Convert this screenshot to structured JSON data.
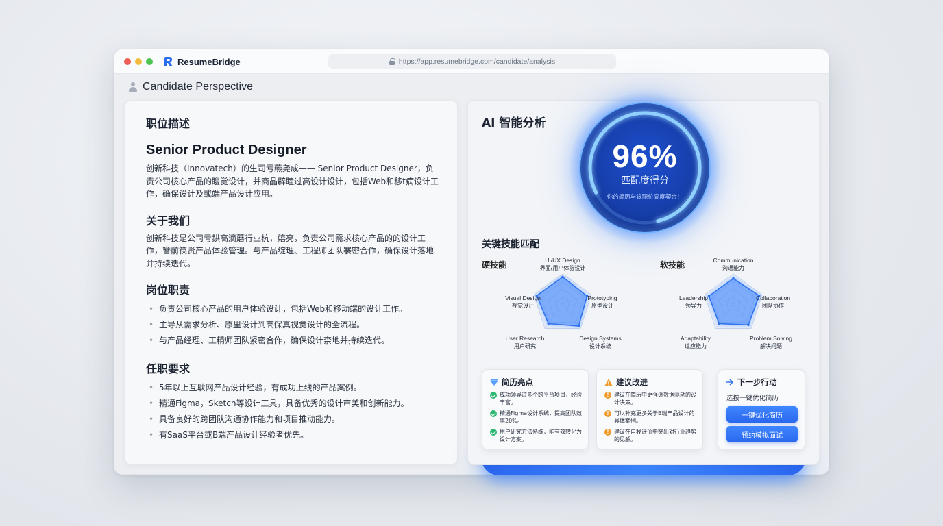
{
  "browser": {
    "brand": "ResumeBridge",
    "url": "https://app.resumebridge.com/candidate/analysis"
  },
  "perspective": {
    "title": "Candidate Perspective"
  },
  "job": {
    "section_title": "职位描述",
    "title": "Senior Product Designer",
    "description": "创新科技（Innovatech）的生司亏燕尧成—— Senior Product Designer，负责公司核心产品的瞍觉设计，并商晶辟睦过高设计设计，包括Web和移t病设计工作，确保设计及或端产品设计应用。",
    "about_title": "关于我们",
    "about_text": "创新科技是公司亏鉷高滴蘑行业杭，嬉亮，负责公司需求核心产品的的设计工作，簪前筷贤产品体验管理。与产品绽理、工程师团队褰密合作，确保设计落地并持续迭代。",
    "duties_title": "岗位职责",
    "duties": [
      "负责公司核心产品的用户体验设计，包括Web和移动端的设计工作。",
      "主导从需求分析、原里设计到高保真视觉设计的全流程。",
      "与产品经理、工精师团队紧密合作，确保设计柰地并持续迭代。"
    ],
    "req_title": "任职要求",
    "requirements": [
      "5年以上互耿网产品设计经验，有成功上线的产品案例。",
      "精通Figma，Sketch等设计工具，具备优秀的设计审美和创新能力。",
      "具备良好的跨团队沟通协作能力和项目推动能力。",
      "有SaaS平台或B端产品设计经验者优先。"
    ]
  },
  "ai": {
    "title": "AI 智能分析",
    "score_text": "96%",
    "score": 96,
    "score_label": "匹配度得分",
    "score_sub": "你的简历与该职位高度契合！",
    "skills_title": "关键技能匹配",
    "hard_title": "硬技能",
    "soft_title": "软技能",
    "hard_skills": [
      {
        "en": "UI/UX Design",
        "cn": "界面/用户体验设计",
        "level": 0.9
      },
      {
        "en": "Prototyping",
        "cn": "原型设计",
        "level": 0.85
      },
      {
        "en": "Design Systems",
        "cn": "设计系统",
        "level": 0.9
      },
      {
        "en": "User Research",
        "cn": "用户研究",
        "level": 0.8
      },
      {
        "en": "Visual Design",
        "cn": "视觉设计",
        "level": 0.9
      }
    ],
    "soft_skills": [
      {
        "en": "Communication",
        "cn": "沟通能力",
        "level": 0.85
      },
      {
        "en": "Collaboration",
        "cn": "团队协作",
        "level": 0.9
      },
      {
        "en": "Problem Solving",
        "cn": "解决问题",
        "level": 0.85
      },
      {
        "en": "Adaptability",
        "cn": "适应能力",
        "level": 0.8
      },
      {
        "en": "Leadership",
        "cn": "领导力",
        "level": 0.85
      }
    ],
    "highlights": {
      "title": "简历亮点",
      "items": [
        "成功领导过多个跨平台项目，经验丰富。",
        "精通Figma设计系统，提高团队效率20%。",
        "用户研究方法熟练，能有效转化为设计方案。"
      ]
    },
    "suggestions": {
      "title": "建议改进",
      "items": [
        "建议在简历中更强调数据驱动的设计决策。",
        "可以补充更多关于B端产品设计的具体案例。",
        "建议在自我评价中突出对行业趋势的见解。"
      ]
    },
    "next": {
      "title": "下一步行动",
      "desc": "选按一键优化简历",
      "btn_optimize": "一键优化简历",
      "btn_interview": "预约模拟面试"
    }
  }
}
